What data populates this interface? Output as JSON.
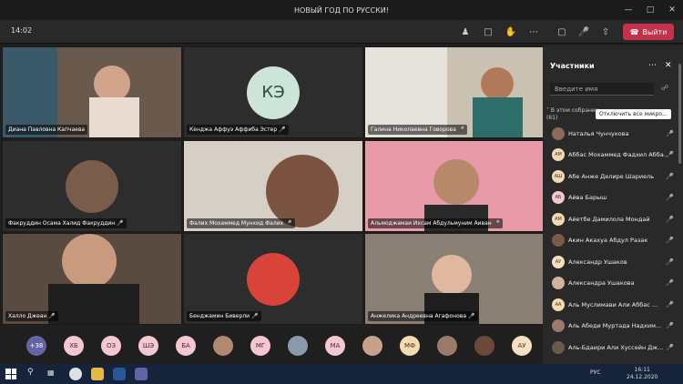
{
  "window": {
    "title": "НОВЫЙ ГОД ПО РУССКИ!",
    "min_icon": "minimize-icon",
    "max_icon": "maximize-icon",
    "close_icon": "close-icon"
  },
  "toolbar": {
    "timer": "14:02",
    "leave_label": "Выйти",
    "icons": [
      "people-icon",
      "chat-icon",
      "raise-hand-icon",
      "more-icon",
      "camera-off-icon",
      "mic-off-icon",
      "share-icon"
    ]
  },
  "tiles": [
    {
      "name": "Диана Павловна Капчаева",
      "bg": "#6a5a4e",
      "initials": ""
    },
    {
      "name": "Кенджа Аффуэ Аффиба Эстер",
      "bg": "#2d2d2d",
      "initials": "КЭ"
    },
    {
      "name": "Галина Николаевна Говорова",
      "bg": "#8a7a60",
      "initials": ""
    },
    {
      "name": "Факруддин Осама Халид Факруддин",
      "bg": "#2d2d2d",
      "initials": ""
    },
    {
      "name": "Фалих Мохаммед Мунхид Фалих",
      "bg": "#c9b9a9",
      "initials": ""
    },
    {
      "name": "Альмоджамаи Ихсам Абдульмуним Аиван",
      "bg": "#e89aa8",
      "initials": ""
    },
    {
      "name": "Халло Джеан",
      "bg": "#5a4b40",
      "initials": ""
    },
    {
      "name": "Бенджамин Биверли",
      "bg": "#2d2d2d",
      "initials": ""
    },
    {
      "name": "Анжелика Андреевна Агафонова",
      "bg": "#8a7f74",
      "initials": ""
    }
  ],
  "bottom_avatars": [
    "+38",
    "ХБ",
    "ОЗ",
    "ШЭ",
    "БА",
    "",
    "МГ",
    "",
    "МА",
    "",
    "МФ",
    "",
    "",
    "АУ"
  ],
  "panel": {
    "title": "Участники",
    "search_placeholder": "Введите имя",
    "section_label": "В этом собрании",
    "section_count": "(61)",
    "mute_all_label": "Отключить все микро...",
    "participants": [
      {
        "name": "Наталья Чунчукова",
        "initials": ""
      },
      {
        "name": "Аббас Мохаммед Фадхил Абба...",
        "initials": "АМ"
      },
      {
        "name": "Абе Анже Делире Шариель",
        "initials": "АШ"
      },
      {
        "name": "Айва Барыш",
        "initials": "АБ"
      },
      {
        "name": "Айетбе Дамилола Мондай",
        "initials": "АМ"
      },
      {
        "name": "Акин Акахуа Абдул Разак",
        "initials": ""
      },
      {
        "name": "Александр Ушаков",
        "initials": "АУ"
      },
      {
        "name": "Александра Ушакова",
        "initials": ""
      },
      {
        "name": "Аль Муслимави Али Аббас ...",
        "initials": "АА"
      },
      {
        "name": "Аль Абеди Муртада Надхим...",
        "initials": ""
      },
      {
        "name": "Аль-Бдаири Али Хуссейн Дж...",
        "initials": ""
      }
    ]
  },
  "taskbar": {
    "lang": "РУС",
    "time": "16:11",
    "date": "24.12.2020"
  },
  "colors": {
    "leave": "#c4314b",
    "panel": "#292929",
    "stage": "#1f1f1f"
  }
}
